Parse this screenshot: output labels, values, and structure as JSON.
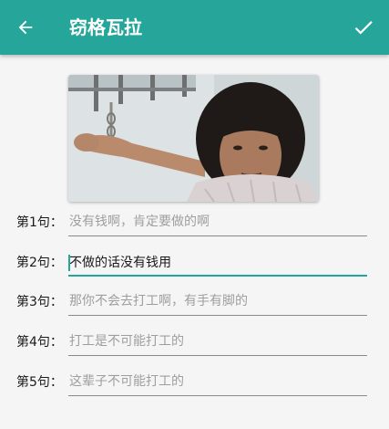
{
  "appbar": {
    "title": "窃格瓦拉",
    "back_icon": "arrow-back-icon",
    "done_icon": "check-icon",
    "color": "#26a69a"
  },
  "image": {
    "alt": "meme template photo"
  },
  "sentences": [
    {
      "label": "第1句：",
      "value": "",
      "placeholder": "没有钱啊，肯定要做的啊",
      "focused": false
    },
    {
      "label": "第2句：",
      "value": "不做的话没有钱用",
      "placeholder": "",
      "focused": true
    },
    {
      "label": "第3句：",
      "value": "",
      "placeholder": "那你不会去打工啊，有手有脚的",
      "focused": false
    },
    {
      "label": "第4句：",
      "value": "",
      "placeholder": "打工是不可能打工的",
      "focused": false
    },
    {
      "label": "第5句：",
      "value": "",
      "placeholder": "这辈子不可能打工的",
      "focused": false
    }
  ],
  "accent_color": "#26a69a"
}
